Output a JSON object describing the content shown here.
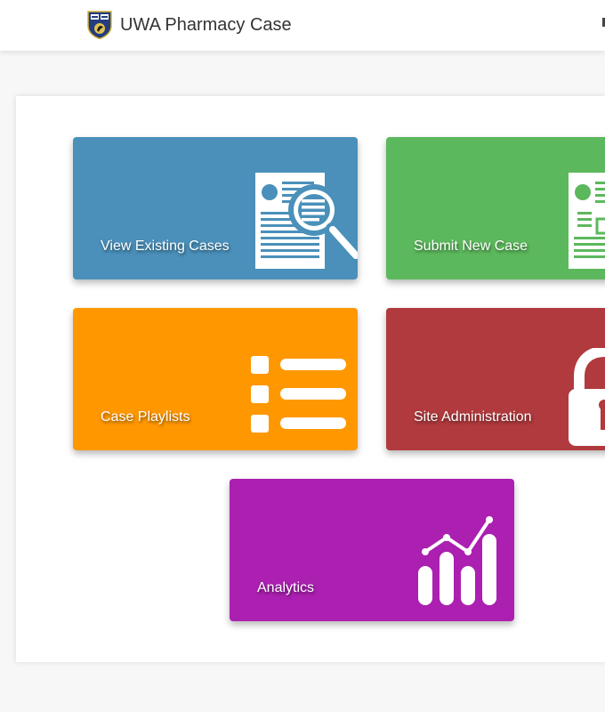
{
  "header": {
    "title": "UWA Pharmacy Case",
    "logo_icon": "uwa-crest-icon"
  },
  "tiles": [
    {
      "label": "View Existing Cases",
      "icon": "document-search-icon",
      "color": "#4a90ba"
    },
    {
      "label": "Submit New Case",
      "icon": "document-add-icon",
      "color": "#5cb85c"
    },
    {
      "label": "Case Playlists",
      "icon": "list-icon",
      "color": "#ff9800"
    },
    {
      "label": "Site Administration",
      "icon": "lock-icon",
      "color": "#b03a3d"
    },
    {
      "label": "Analytics",
      "icon": "bar-line-chart-icon",
      "color": "#ab20b0"
    }
  ]
}
